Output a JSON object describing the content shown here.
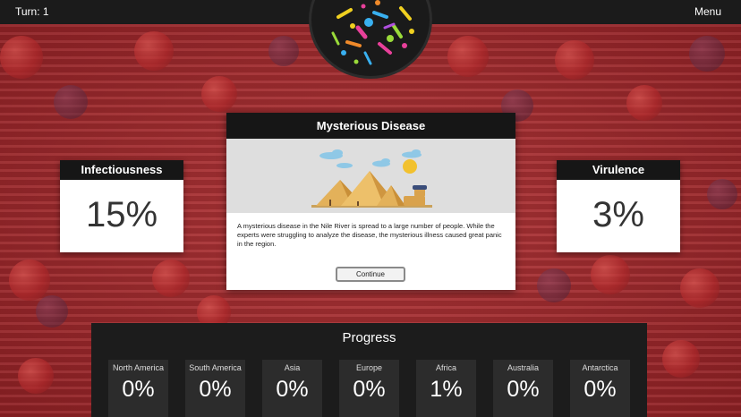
{
  "topbar": {
    "turn_label": "Turn: 1",
    "menu_label": "Menu"
  },
  "stats": {
    "infectiousness": {
      "label": "Infectiousness",
      "value": "15%"
    },
    "virulence": {
      "label": "Virulence",
      "value": "3%"
    }
  },
  "dialog": {
    "title": "Mysterious Disease",
    "body": "A mysterious disease in the Nile River is spread to a large number of people. While the experts were struggling to analyze the disease, the mysterious illness caused great panic in the region.",
    "button_label": "Continue"
  },
  "progress": {
    "title": "Progress",
    "regions": [
      {
        "name": "North America",
        "value": "0%"
      },
      {
        "name": "South America",
        "value": "0%"
      },
      {
        "name": "Asia",
        "value": "0%"
      },
      {
        "name": "Europe",
        "value": "0%"
      },
      {
        "name": "Africa",
        "value": "1%"
      },
      {
        "name": "Australia",
        "value": "0%"
      },
      {
        "name": "Antarctica",
        "value": "0%"
      }
    ]
  },
  "colors": {
    "background": "#a3292c",
    "panel": "#1c1c1c",
    "header": "#161616"
  }
}
